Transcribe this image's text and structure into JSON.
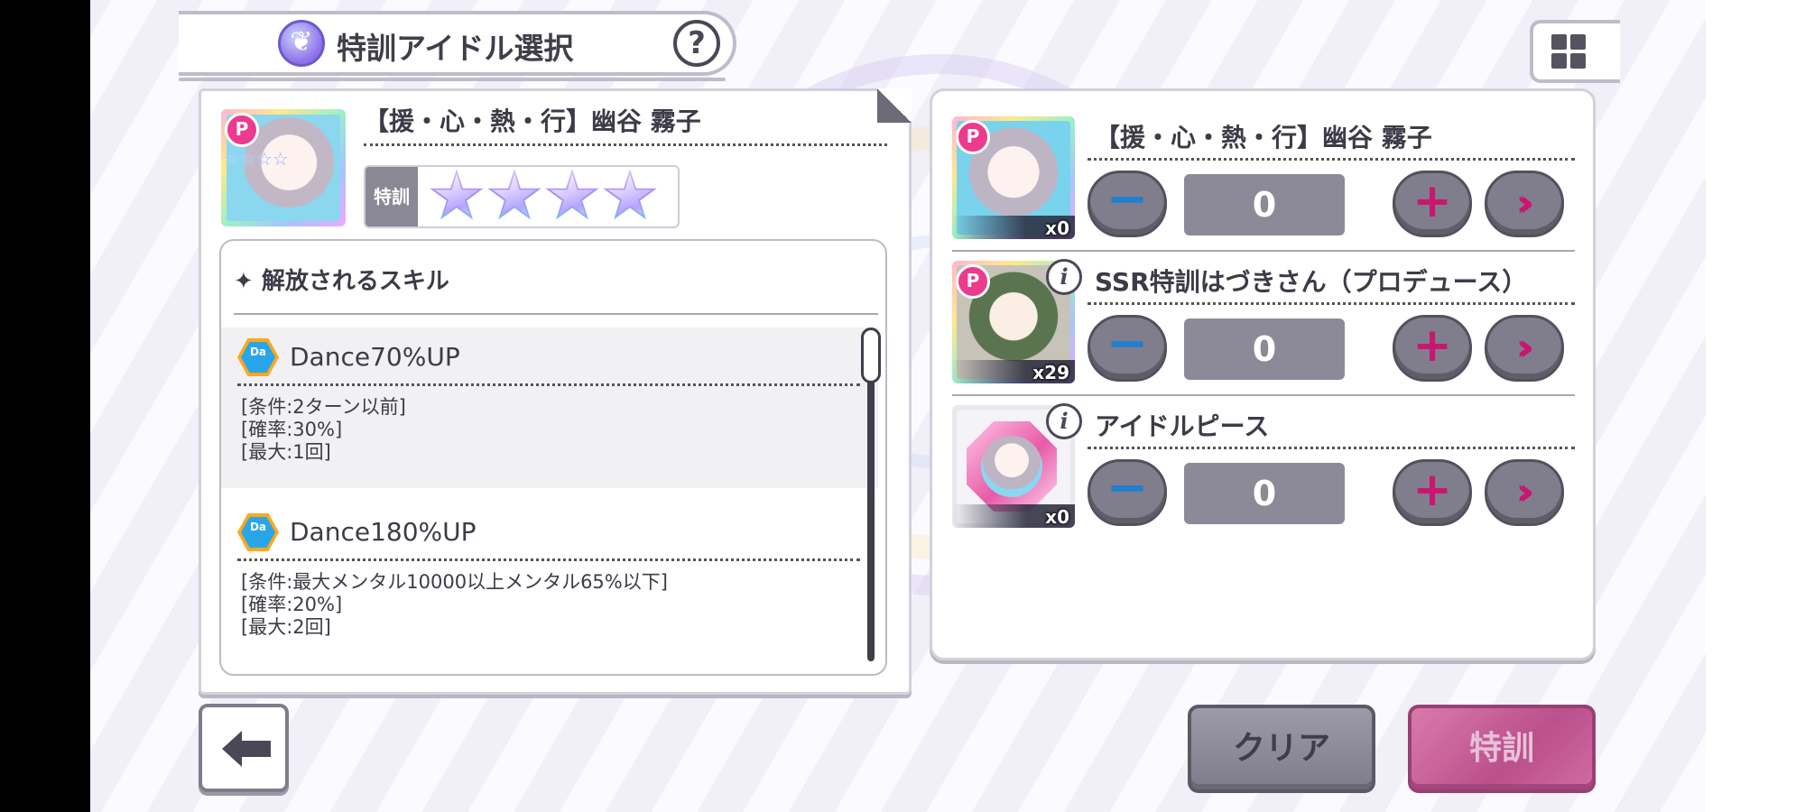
{
  "header": {
    "title": "特訓アイドル選択",
    "title_icon": "feather-badge-icon",
    "help_label": "?",
    "grid_icon": "grid-icon"
  },
  "selected_card": {
    "prefix_badge": "P",
    "name": "【援・心・熱・行】幽谷 霧子",
    "mini_stars": "☆☆☆☆",
    "training_label": "特訓",
    "training_stars_filled": 4,
    "training_stars_total": 4
  },
  "skills": {
    "header": "✦ 解放されるスキル",
    "items": [
      {
        "icon": "dance-up-icon",
        "name": "Dance70%UP",
        "details": [
          "[条件:2ターン以前]",
          "[確率:30%]",
          "[最大:1回]"
        ]
      },
      {
        "icon": "dance-up-icon",
        "name": "Dance180%UP",
        "details": [
          "[条件:最大メンタル10000以上メンタル65%以下]",
          "[確率:20%]",
          "[最大:2回]"
        ]
      }
    ]
  },
  "materials": [
    {
      "prefix_badge": "P",
      "name": "【援・心・熱・行】幽谷 霧子",
      "owned": "x0",
      "count": "0",
      "has_info": false
    },
    {
      "prefix_badge": "P",
      "name": "SSR特訓はづきさん（プロデュース）",
      "owned": "x29",
      "count": "0",
      "has_info": true
    },
    {
      "prefix_badge": "",
      "name": "アイドルピース",
      "owned": "x0",
      "count": "0",
      "has_info": true
    }
  ],
  "controls": {
    "minus": "−",
    "plus": "+",
    "max": "»",
    "info": "i"
  },
  "buttons": {
    "back_icon": "back-arrow-icon",
    "clear": "クリア",
    "train": "特訓"
  },
  "colors": {
    "accent_pink": "#c9176f",
    "minus_blue": "#1f7fd0",
    "panel_border": "#d2d0da",
    "button_grey": "#807e8c"
  }
}
